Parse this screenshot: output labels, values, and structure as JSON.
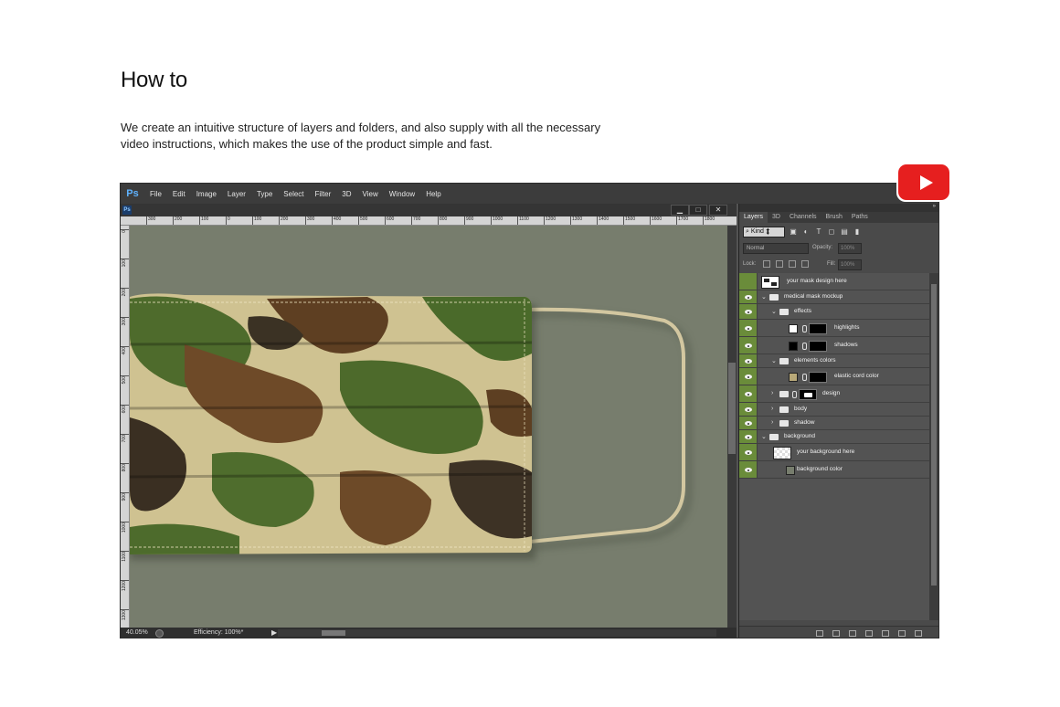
{
  "page": {
    "heading": "How to",
    "description": "We create an intuitive structure of layers and folders, and also supply with all the necessary video instructions, which makes the use of the product simple and fast."
  },
  "app": {
    "logo": "Ps",
    "menu": [
      "File",
      "Edit",
      "Image",
      "Layer",
      "Type",
      "Select",
      "Filter",
      "3D",
      "View",
      "Window",
      "Help"
    ]
  },
  "document": {
    "ruler_h": [
      "300",
      "200",
      "100",
      "0",
      "100",
      "200",
      "300",
      "400",
      "500",
      "600",
      "700",
      "800",
      "900",
      "1000",
      "1100",
      "1200",
      "1300",
      "1400",
      "1500",
      "1600",
      "1700",
      "1800"
    ],
    "ruler_v": [
      "0",
      "100",
      "200",
      "300",
      "400",
      "500",
      "600",
      "700",
      "800",
      "900",
      "1000",
      "1100",
      "1200",
      "1300"
    ],
    "zoom": "40.05%",
    "efficiency": "Efficiency: 100%*",
    "window_controls": [
      "▁",
      "□",
      "✕"
    ]
  },
  "layers_panel": {
    "tabs": [
      "Layers",
      "3D",
      "Channels",
      "Brush",
      "Paths"
    ],
    "kind_label": "Kind",
    "blend_mode": "Normal",
    "opacity_label": "Opacity:",
    "opacity_value": "100%",
    "lock_label": "Lock:",
    "fill_label": "Fill:",
    "fill_value": "100%",
    "layers": [
      {
        "name": "your mask design here",
        "visible": false,
        "type": "smart",
        "indent": 0
      },
      {
        "name": "medical mask mockup",
        "visible": true,
        "type": "folder-open",
        "indent": 0
      },
      {
        "name": "effects",
        "visible": true,
        "type": "folder-open",
        "indent": 1
      },
      {
        "name": "highlights",
        "visible": true,
        "type": "adjust-white",
        "indent": 2
      },
      {
        "name": "shadows",
        "visible": true,
        "type": "adjust-black",
        "indent": 2
      },
      {
        "name": "elements colors",
        "visible": true,
        "type": "folder-open",
        "indent": 1
      },
      {
        "name": "elastic cord color",
        "visible": true,
        "type": "adjust-tan",
        "indent": 2
      },
      {
        "name": "design",
        "visible": true,
        "type": "folder-masked",
        "indent": 1
      },
      {
        "name": "body",
        "visible": true,
        "type": "folder-closed",
        "indent": 1
      },
      {
        "name": "shadow",
        "visible": true,
        "type": "folder-closed",
        "indent": 1
      },
      {
        "name": "background",
        "visible": true,
        "type": "folder-open",
        "indent": 0
      },
      {
        "name": "your background here",
        "visible": true,
        "type": "transparent",
        "indent": 1
      },
      {
        "name": "background color",
        "visible": true,
        "type": "fill-olive",
        "indent": 1
      }
    ]
  },
  "colors": {
    "canvas_bg": "#777d6d",
    "eye_column": "#6a8c3a",
    "cord": "#d3c7a0",
    "youtube_red": "#e61f1f"
  },
  "youtube_icon": "youtube-play-icon"
}
